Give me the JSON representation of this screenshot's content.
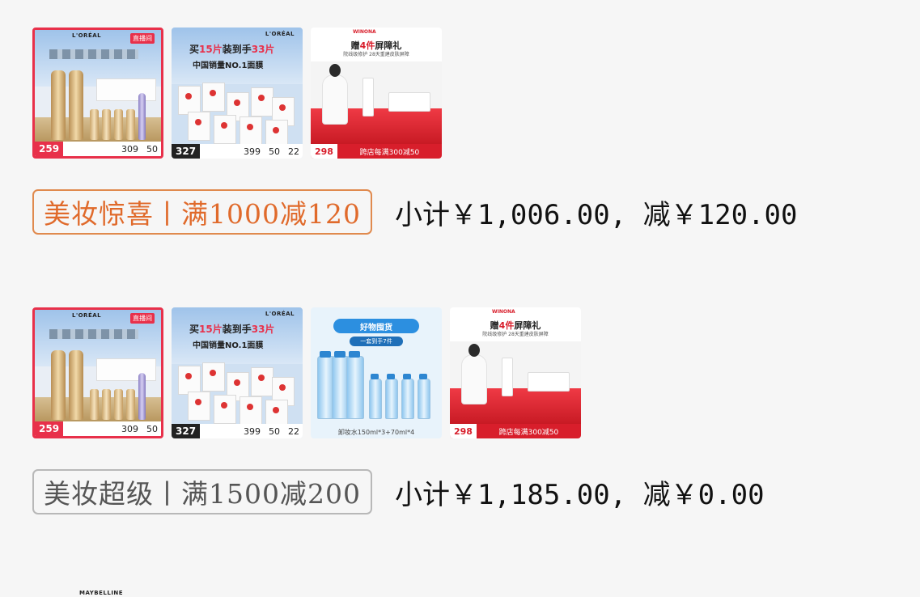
{
  "groups": [
    {
      "promo_label": "美妆惊喜丨满1000减120",
      "promo_color": "#e08a4e",
      "subtotal": "小计￥1,006.00, 减￥120.00",
      "products": [
        {
          "type": "serum-set",
          "brand": "L'ORÉAL",
          "tag": "直播间",
          "price": "259",
          "sub1": "309",
          "sub2": "50"
        },
        {
          "type": "masks",
          "brand": "L'ORÉAL",
          "headline_a": "买",
          "headline_b": "15片",
          "headline_c": "装到手",
          "headline_d": "33片",
          "sub": "中国销量NO.1面膜",
          "price": "327",
          "sub1": "399",
          "sub2": "50",
          "sub3": "22"
        },
        {
          "type": "winona",
          "brand": "WINONA",
          "title_a": "赠",
          "title_b": "4件",
          "title_c": "屏障礼",
          "subtitle": "院线级修护 28天重建皮肤屏障",
          "price": "298",
          "promo": "跨店每满300减50"
        }
      ]
    },
    {
      "promo_label": "美妆超级丨满1500减200",
      "promo_color": "#b8b8b8",
      "subtotal": "小计￥1,185.00, 减￥0.00",
      "products": [
        {
          "type": "serum-set",
          "brand": "L'ORÉAL",
          "tag": "直播间",
          "price": "259",
          "sub1": "309",
          "sub2": "50"
        },
        {
          "type": "masks",
          "brand": "L'ORÉAL",
          "headline_a": "买",
          "headline_b": "15片",
          "headline_c": "装到手",
          "headline_d": "33片",
          "sub": "中国销量NO.1面膜",
          "price": "327",
          "sub1": "399",
          "sub2": "50",
          "sub3": "22"
        },
        {
          "type": "micellar",
          "title": "好物囤货",
          "sub": "一套到手7件",
          "caption": "卸妆水150ml*3+70ml*4"
        },
        {
          "type": "winona",
          "brand": "WINONA",
          "title_a": "赠",
          "title_b": "4件",
          "title_c": "屏障礼",
          "subtitle": "院线级修护 28天重建皮肤屏障",
          "price": "298",
          "promo": "跨店每满300减50"
        }
      ]
    }
  ],
  "footer_brand": "MAYBELLINE"
}
